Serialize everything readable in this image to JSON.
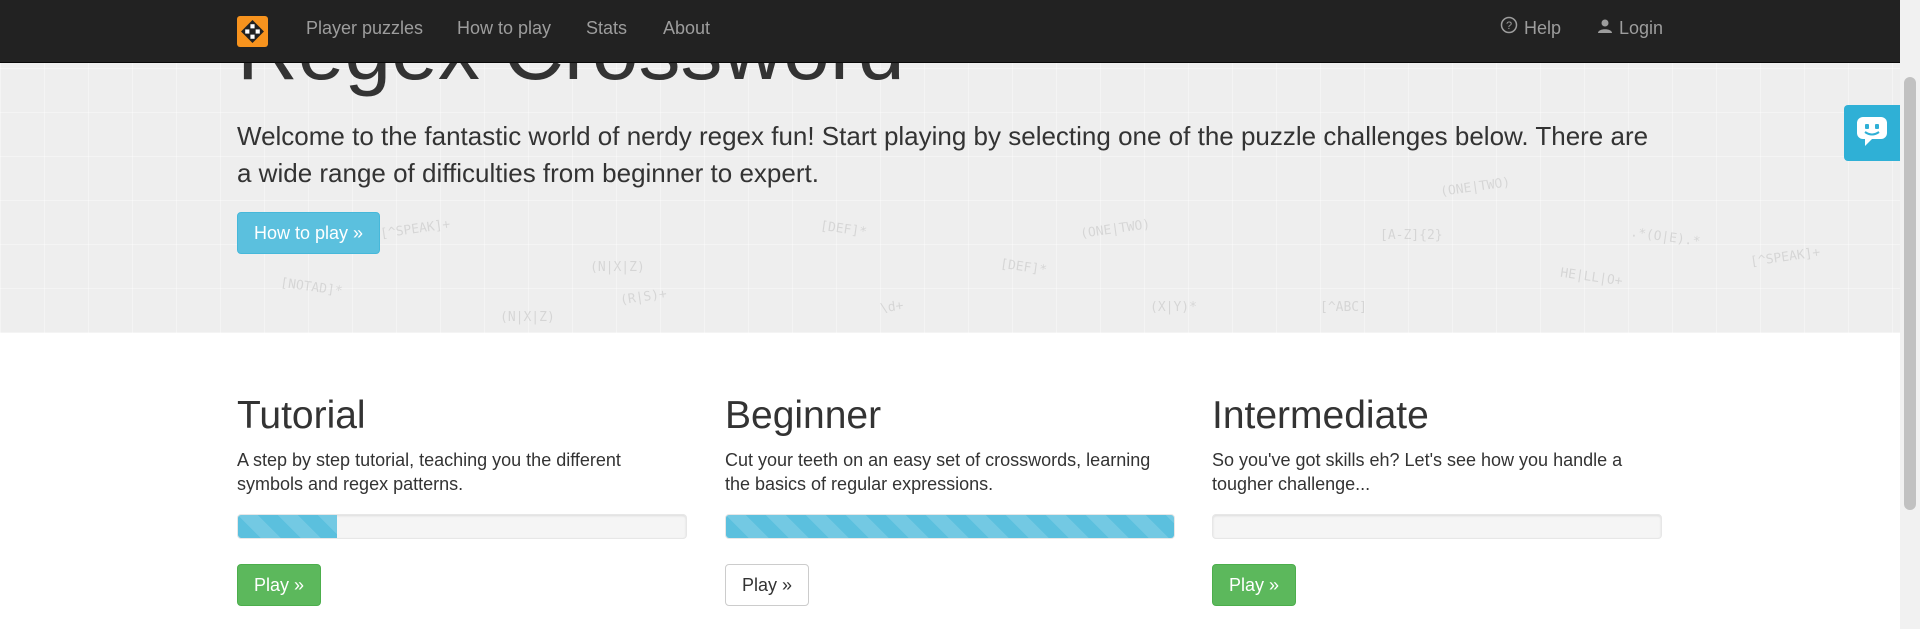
{
  "navbar": {
    "logo_icon": "regex-crossword-logo-icon",
    "links": [
      "Player puzzles",
      "How to play",
      "Stats",
      "About"
    ],
    "help_label": "Help",
    "login_label": "Login"
  },
  "hero": {
    "title": "Regex Crossword",
    "lead": "Welcome to the fantastic world of nerdy regex fun! Start playing by selecting one of the puzzle challenges below. There are a wide range of difficulties from beginner to expert.",
    "button_label": "How to play »"
  },
  "feedback": {
    "icon": "chat-feedback-icon"
  },
  "challenges": [
    {
      "title": "Tutorial",
      "description": "A step by step tutorial, teaching you the different symbols and regex patterns.",
      "progress": 0.22,
      "button_label": "Play »",
      "button_style": "success"
    },
    {
      "title": "Beginner",
      "description": "Cut your teeth on an easy set of crosswords, learning the basics of regular expressions.",
      "progress": 1.0,
      "button_label": "Play »",
      "button_style": "default"
    },
    {
      "title": "Intermediate",
      "description": "So you've got skills eh? Let's see how you handle a tougher challenge...",
      "progress": 0.0,
      "button_label": "Play »",
      "button_style": "success"
    }
  ],
  "colors": {
    "navbar_bg": "#222222",
    "info": "#5bc0de",
    "success": "#5cb85c",
    "logo": "#f7931e"
  }
}
